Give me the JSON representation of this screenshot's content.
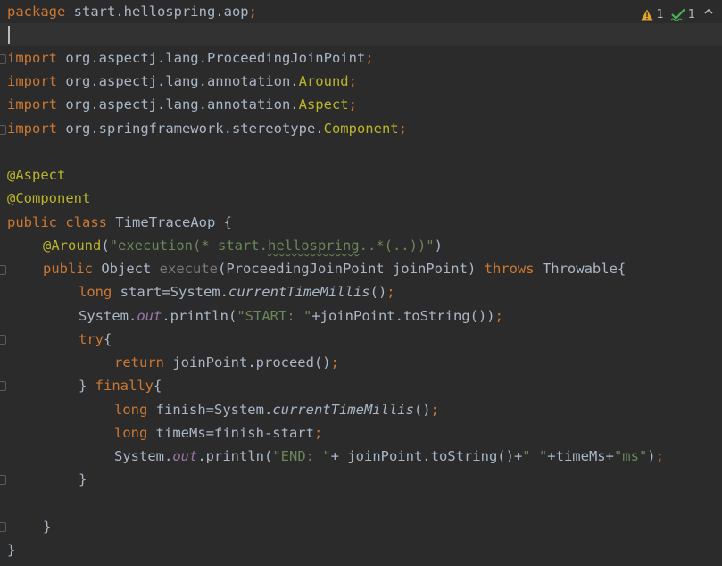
{
  "editor": {
    "status": {
      "warning_count": "1",
      "check_count": "1",
      "warning_color": "#e0a22a",
      "check_color": "#4caf50"
    },
    "lines": {
      "l1": {
        "pkg": "package",
        "name": " start.hellospring.aop",
        "semi": ";"
      },
      "l3": {
        "kw": "import",
        "path": " org.aspectj.lang.ProceedingJoinPoint",
        "semi": ";"
      },
      "l4": {
        "kw": "import",
        "path": " org.aspectj.lang.annotation.",
        "cls": "Around",
        "semi": ";"
      },
      "l5": {
        "kw": "import",
        "path": " org.aspectj.lang.annotation.",
        "cls": "Aspect",
        "semi": ";"
      },
      "l6": {
        "kw": "import",
        "path": " org.springframework.stereotype.",
        "cls": "Component",
        "semi": ";"
      },
      "l8": {
        "ann": "@Aspect"
      },
      "l9": {
        "ann": "@Component"
      },
      "l10": {
        "kw1": "public",
        "kw2": " class",
        "name": " TimeTraceAop {"
      },
      "l11": {
        "ann": "@Around",
        "p1": "(",
        "str1": "\"execution(* start.",
        "squig": "hellospring",
        "str2": "..*(..))\"",
        "p2": ")"
      },
      "l12": {
        "kw1": "public",
        "type": " Object ",
        "method": "execute",
        "params": "(ProceedingJoinPoint joinPoint) ",
        "throws": "throws",
        "rest": " Throwable{"
      },
      "l13": {
        "kw": "long",
        "a": " start=System.",
        "m": "currentTimeMillis",
        "b": "()",
        "semi": ";"
      },
      "l14": {
        "a": "System.",
        "f": "out",
        "b": ".println(",
        "s": "\"START: \"",
        "c": "+joinPoint.toString())",
        "semi": ";"
      },
      "l15": {
        "kw": "try",
        "b": "{"
      },
      "l16": {
        "kw": "return",
        "a": " joinPoint.proceed()",
        "semi": ";"
      },
      "l17": {
        "a": "} ",
        "kw": "finally",
        "b": "{"
      },
      "l18": {
        "kw": "long",
        "a": " finish=System.",
        "m": "currentTimeMillis",
        "b": "()",
        "semi": ";"
      },
      "l19": {
        "kw": "long",
        "a": " timeMs=finish-start",
        "semi": ";"
      },
      "l20": {
        "a": "System.",
        "f": "out",
        "b": ".println(",
        "s1": "\"END: \"",
        "c": "+ joinPoint.toString()+",
        "s2": "\" \"",
        "d": "+timeMs+",
        "s3": "\"ms\"",
        "e": ")",
        "semi": ";"
      },
      "l21": {
        "a": "}"
      },
      "l23": {
        "a": "}"
      },
      "l24": {
        "a": "}"
      }
    }
  }
}
